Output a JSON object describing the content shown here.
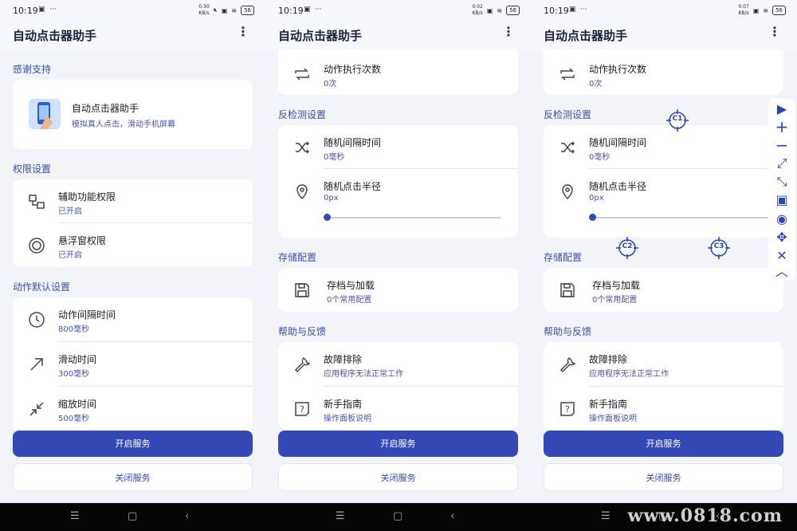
{
  "app_title": "自动点击器助手",
  "menu_icon": "more-vert-icon",
  "status": [
    {
      "time": "10:19",
      "net": "0.30\nKB/s",
      "battery": "56"
    },
    {
      "time": "10:19",
      "net": "0.02\nKB/s",
      "battery": "56"
    },
    {
      "time": "10:19",
      "net": "0.07\nKB/s",
      "battery": "56"
    }
  ],
  "screen1": {
    "thanks_title": "感谢支持",
    "thanks_card": {
      "title": "自动点击器助手",
      "subtitle": "模拟真人点击，滑动手机屏幕"
    },
    "perm_title": "权限设置",
    "perms": [
      {
        "label": "辅助功能权限",
        "value": "已开启",
        "icon": "accessibility-icon"
      },
      {
        "label": "悬浮窗权限",
        "value": "已开启",
        "icon": "floating-window-icon"
      }
    ],
    "defaults_title": "动作默认设置",
    "defaults": [
      {
        "label": "动作间隔时间",
        "value": "800毫秒",
        "icon": "clock-icon"
      },
      {
        "label": "滑动时间",
        "value": "300毫秒",
        "icon": "arrow-up-right-icon"
      },
      {
        "label": "缩放时间",
        "value": "500毫秒",
        "icon": "zoom-in-arrows-icon"
      }
    ]
  },
  "screen2": {
    "exec_count": {
      "label": "动作执行次数",
      "value": "0次",
      "icon": "repeat-icon"
    },
    "anti_title": "反检测设置",
    "anti": [
      {
        "label": "随机间隔时间",
        "value": "0毫秒",
        "icon": "shuffle-icon"
      },
      {
        "label": "随机点击半径",
        "value": "0px",
        "icon": "location-icon"
      }
    ],
    "radius_slider_fraction": 0,
    "storage_title": "存储配置",
    "storage": {
      "label": "存档与加载",
      "value": "0个常用配置",
      "icon": "save-icon"
    },
    "help_title": "帮助与反馈",
    "help": [
      {
        "label": "故障排除",
        "value": "应用程序无法正常工作",
        "icon": "wrench-icon"
      },
      {
        "label": "新手指南",
        "value": "操作面板说明",
        "icon": "help-square-icon"
      }
    ]
  },
  "buttons": {
    "start": "开启服务",
    "stop": "关闭服务"
  },
  "targets": [
    "C1",
    "C2",
    "C3"
  ],
  "toolbar_icons": [
    "play-icon",
    "plus-icon",
    "minus-icon",
    "expand-icon",
    "collapse-icon",
    "save-icon",
    "eye-icon",
    "move-icon",
    "close-icon",
    "chevron-up-icon"
  ],
  "watermark": "www.0818.com",
  "colors": {
    "primary": "#3449b6",
    "section": "#3a4fa8",
    "background": "#f3f4f9"
  }
}
